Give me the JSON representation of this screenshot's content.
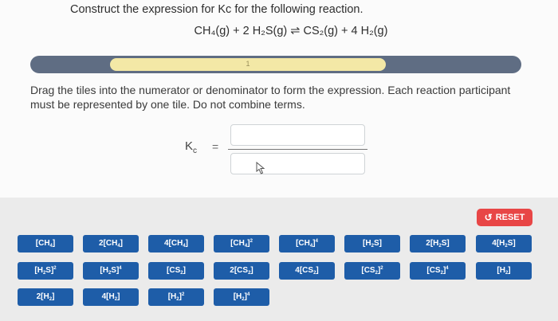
{
  "question": "Construct the expression for Kc for the following reaction.",
  "equation": {
    "reactant1": "CH₄(g)",
    "plus1": "+",
    "reactant2": "2 H₂S(g)",
    "arrow": "⇌",
    "product1": "CS₂(g)",
    "plus2": "+",
    "product2": "4 H₂(g)"
  },
  "progress": {
    "label": "1",
    "fraction": 0.67
  },
  "instructions": "Drag the tiles into the numerator or denominator to form the expression. Each reaction participant must be represented by one tile. Do not combine terms.",
  "kc": {
    "symbol": "K",
    "subscript": "c",
    "equals": "="
  },
  "reset": {
    "label": "RESET",
    "icon": "undo-icon"
  },
  "colors": {
    "tile": "#1e5da8",
    "reset": "#e84646",
    "track": "#5f6d83",
    "fill": "#f3e8a6"
  },
  "tiles": [
    {
      "pre": "",
      "sp": "CH",
      "sub": "4",
      "post": "]",
      "sup": ""
    },
    {
      "pre": "2",
      "sp": "CH",
      "sub": "4",
      "post": "]",
      "sup": ""
    },
    {
      "pre": "4",
      "sp": "CH",
      "sub": "4",
      "post": "]",
      "sup": ""
    },
    {
      "pre": "",
      "sp": "CH",
      "sub": "4",
      "post": "]",
      "sup": "2"
    },
    {
      "pre": "",
      "sp": "CH",
      "sub": "4",
      "post": "]",
      "sup": "4"
    },
    {
      "pre": "",
      "sp": "H",
      "sub": "2",
      "post": "S]",
      "sup": ""
    },
    {
      "pre": "2",
      "sp": "H",
      "sub": "2",
      "post": "S]",
      "sup": ""
    },
    {
      "pre": "4",
      "sp": "H",
      "sub": "2",
      "post": "S]",
      "sup": ""
    },
    {
      "pre": "",
      "sp": "H",
      "sub": "2",
      "post": "S]",
      "sup": "2"
    },
    {
      "pre": "",
      "sp": "H",
      "sub": "2",
      "post": "S]",
      "sup": "4"
    },
    {
      "pre": "",
      "sp": "CS",
      "sub": "2",
      "post": "]",
      "sup": ""
    },
    {
      "pre": "2",
      "sp": "CS",
      "sub": "2",
      "post": "]",
      "sup": ""
    },
    {
      "pre": "4",
      "sp": "CS",
      "sub": "2",
      "post": "]",
      "sup": ""
    },
    {
      "pre": "",
      "sp": "CS",
      "sub": "2",
      "post": "]",
      "sup": "2"
    },
    {
      "pre": "",
      "sp": "CS",
      "sub": "2",
      "post": "]",
      "sup": "4"
    },
    {
      "pre": "",
      "sp": "H",
      "sub": "2",
      "post": "]",
      "sup": ""
    },
    {
      "pre": "2",
      "sp": "H",
      "sub": "2",
      "post": "]",
      "sup": ""
    },
    {
      "pre": "4",
      "sp": "H",
      "sub": "2",
      "post": "]",
      "sup": ""
    },
    {
      "pre": "",
      "sp": "H",
      "sub": "2",
      "post": "]",
      "sup": "2"
    },
    {
      "pre": "",
      "sp": "H",
      "sub": "2",
      "post": "]",
      "sup": "4"
    }
  ]
}
